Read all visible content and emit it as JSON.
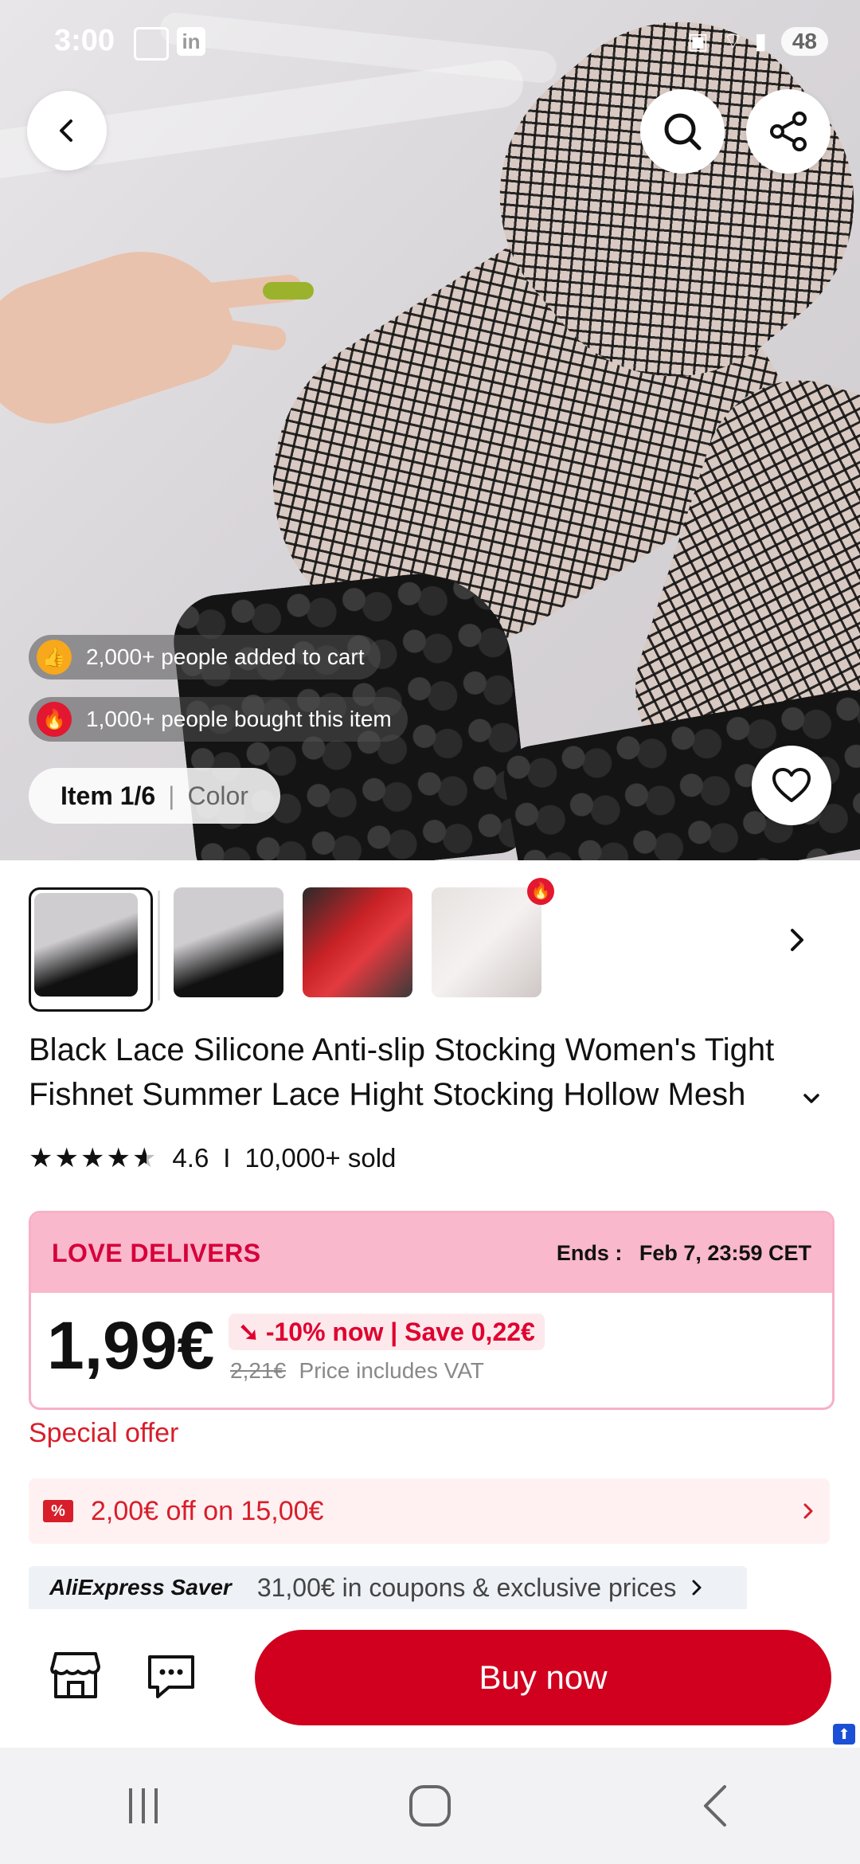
{
  "status_bar": {
    "time": "3:00",
    "battery": "48"
  },
  "social_proof": {
    "added_to_cart": "2,000+ people added to cart",
    "bought": "1,000+ people bought this item"
  },
  "gallery": {
    "item_index": "Item 1/6",
    "separator": "|",
    "color_label": "Color"
  },
  "product": {
    "title": "Black Lace Silicone Anti-slip Stocking Women's Tight Fishnet Summer Lace Hight Stocking Hollow Mesh",
    "rating": "4.6",
    "separator": "I",
    "sold": "10,000+ sold"
  },
  "promo": {
    "banner": "LOVE DELIVERS",
    "ends_label": "Ends :",
    "ends_value": "Feb 7, 23:59 CET",
    "price": "1,99€",
    "discount": "-10% now | Save 0,22€",
    "old_price": "2,21€",
    "vat_note": "Price includes VAT"
  },
  "special_offer": "Special offer",
  "coupon": {
    "text": "2,00€ off on 15,00€",
    "icon_text": "%"
  },
  "saver": {
    "brand": "AliExpress Saver",
    "text": "31,00€ in coupons & exclusive prices"
  },
  "actions": {
    "buy_now": "Buy now"
  },
  "colors": {
    "accent": "#d0001e",
    "promo_pink": "#f9b8cc",
    "promo_text": "#d6003a"
  }
}
